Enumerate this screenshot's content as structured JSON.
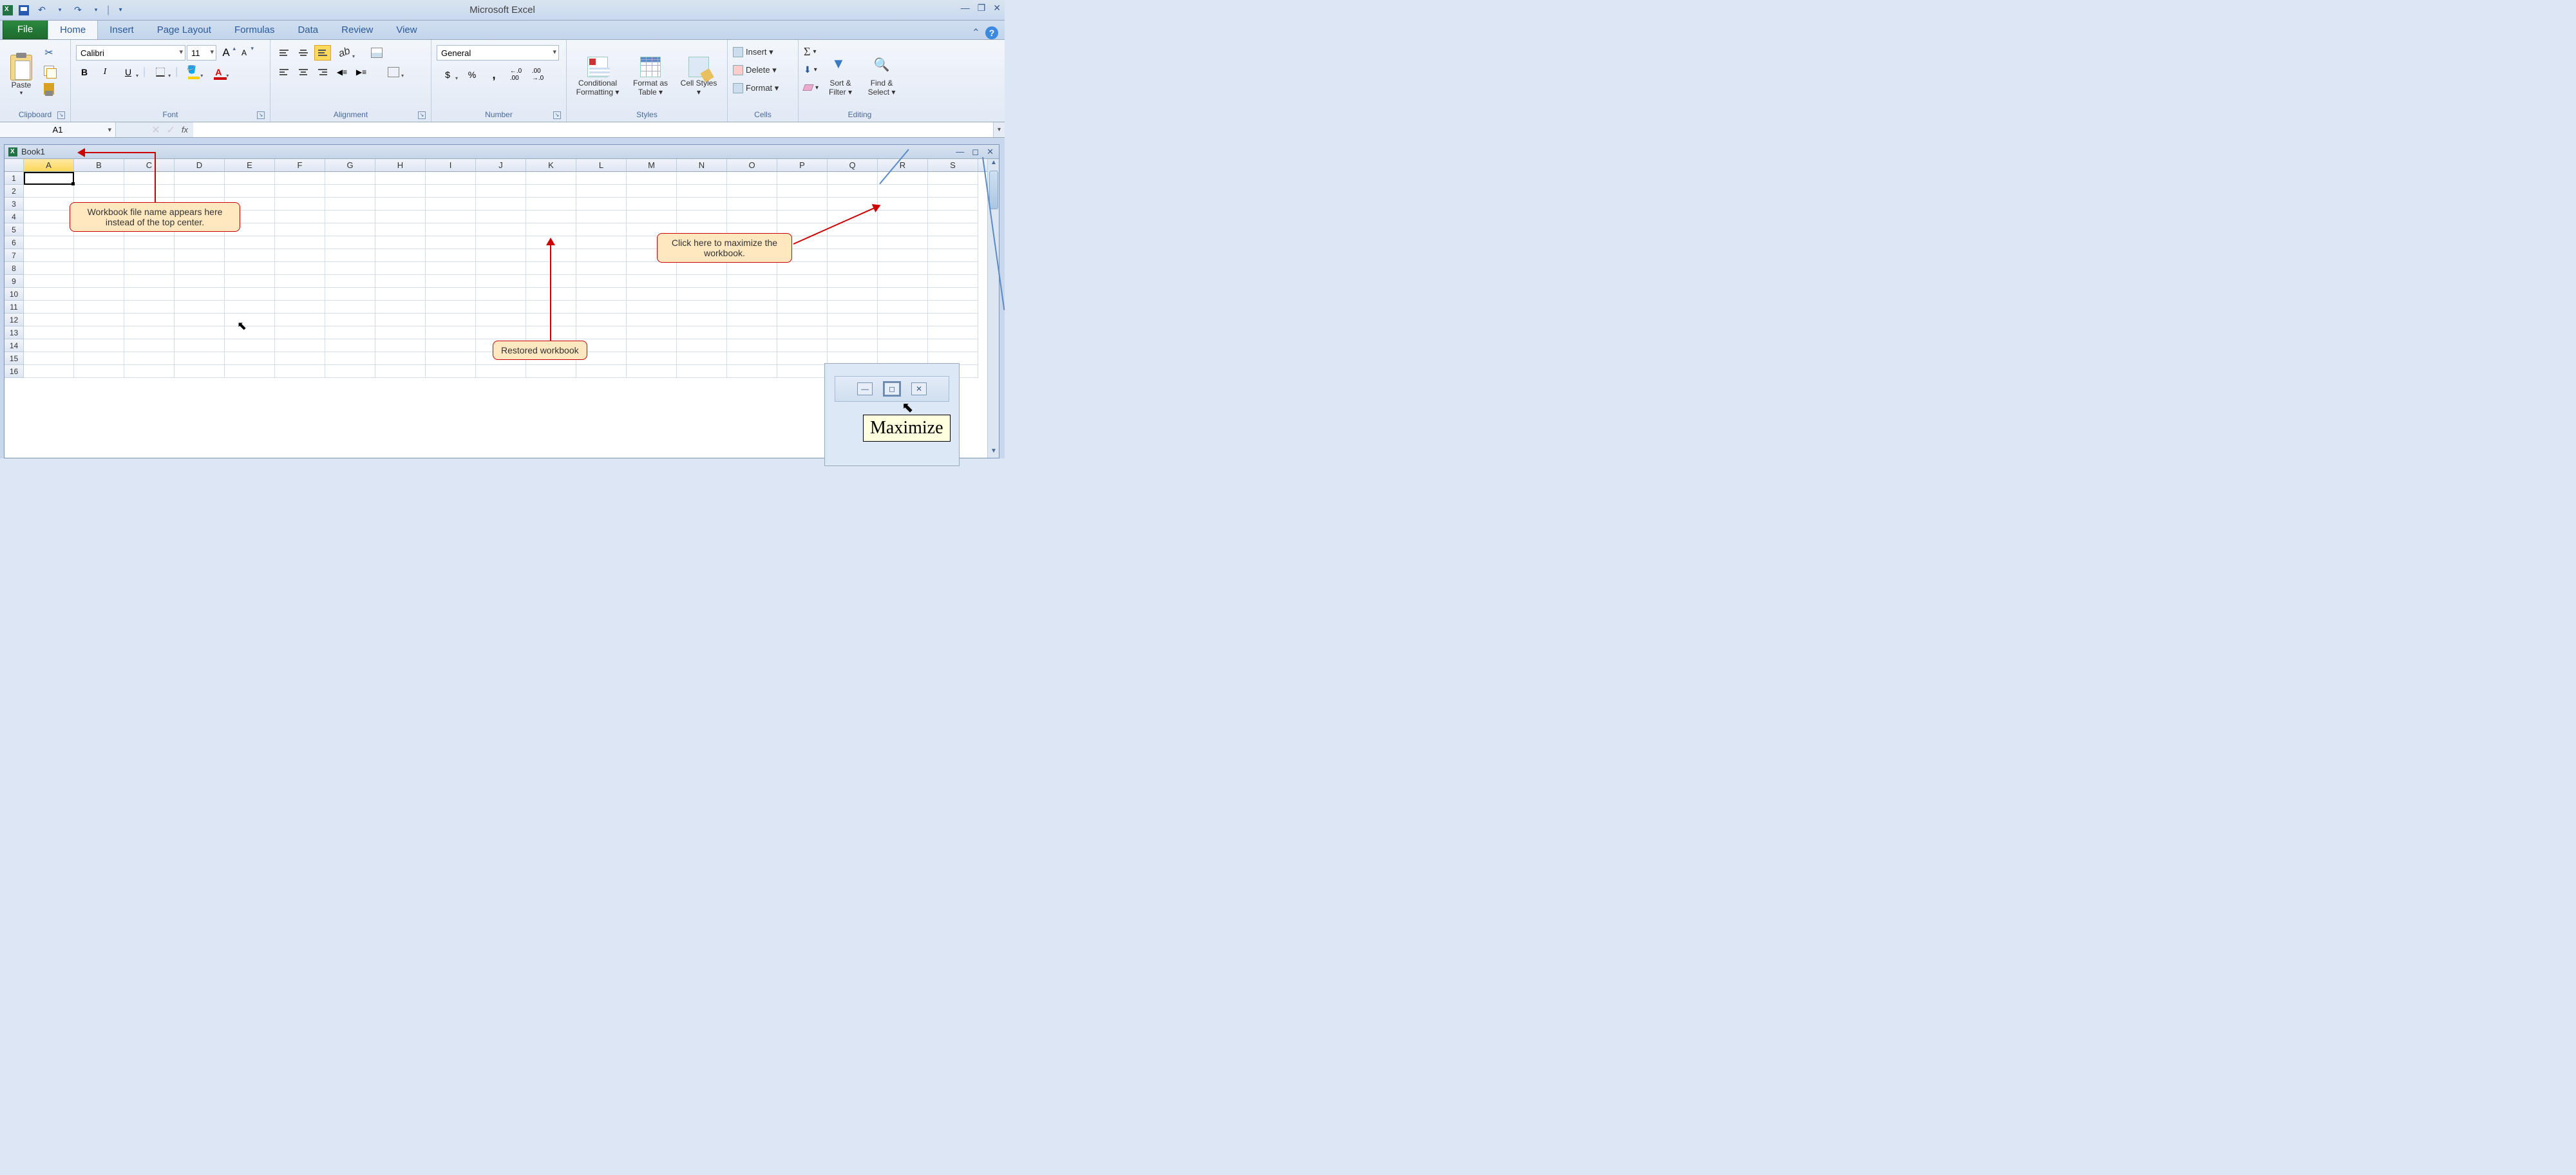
{
  "app_title": "Microsoft Excel",
  "qat": {
    "undo": "↶",
    "redo": "↷",
    "customize": "▾"
  },
  "tabs": {
    "file": "File",
    "items": [
      "Home",
      "Insert",
      "Page Layout",
      "Formulas",
      "Data",
      "Review",
      "View"
    ],
    "active": "Home"
  },
  "ribbon": {
    "clipboard": {
      "label": "Clipboard",
      "paste": "Paste"
    },
    "font": {
      "label": "Font",
      "name": "Calibri",
      "size": "11",
      "bold": "B",
      "italic": "I",
      "underline": "U",
      "grow": "A",
      "shrink": "A",
      "fontcolor_letter": "A"
    },
    "alignment": {
      "label": "Alignment"
    },
    "number": {
      "label": "Number",
      "format": "General",
      "currency": "$",
      "percent": "%",
      "comma": ",",
      "inc": ".00→.0",
      "dec": ".0→.00"
    },
    "styles": {
      "label": "Styles",
      "conditional": "Conditional Formatting ▾",
      "table": "Format as Table ▾",
      "cell": "Cell Styles ▾"
    },
    "cells": {
      "label": "Cells",
      "insert": "Insert ▾",
      "delete": "Delete ▾",
      "format": "Format ▾"
    },
    "editing": {
      "label": "Editing",
      "sigma": "Σ",
      "sort": "Sort & Filter ▾",
      "find": "Find & Select ▾"
    }
  },
  "formula_bar": {
    "name_box": "A1",
    "fx": "fx"
  },
  "workbook": {
    "name": "Book1",
    "columns": [
      "A",
      "B",
      "C",
      "D",
      "E",
      "F",
      "G",
      "H",
      "I",
      "J",
      "K",
      "L",
      "M",
      "N",
      "O",
      "P",
      "Q",
      "R",
      "S"
    ],
    "rows_visible": 16,
    "selected_cell": "A1"
  },
  "callouts": {
    "filename": "Workbook file name appears here instead of the top center.",
    "restored": "Restored workbook",
    "maximize": "Click here to maximize the workbook.",
    "tooltip": "Maximize"
  }
}
